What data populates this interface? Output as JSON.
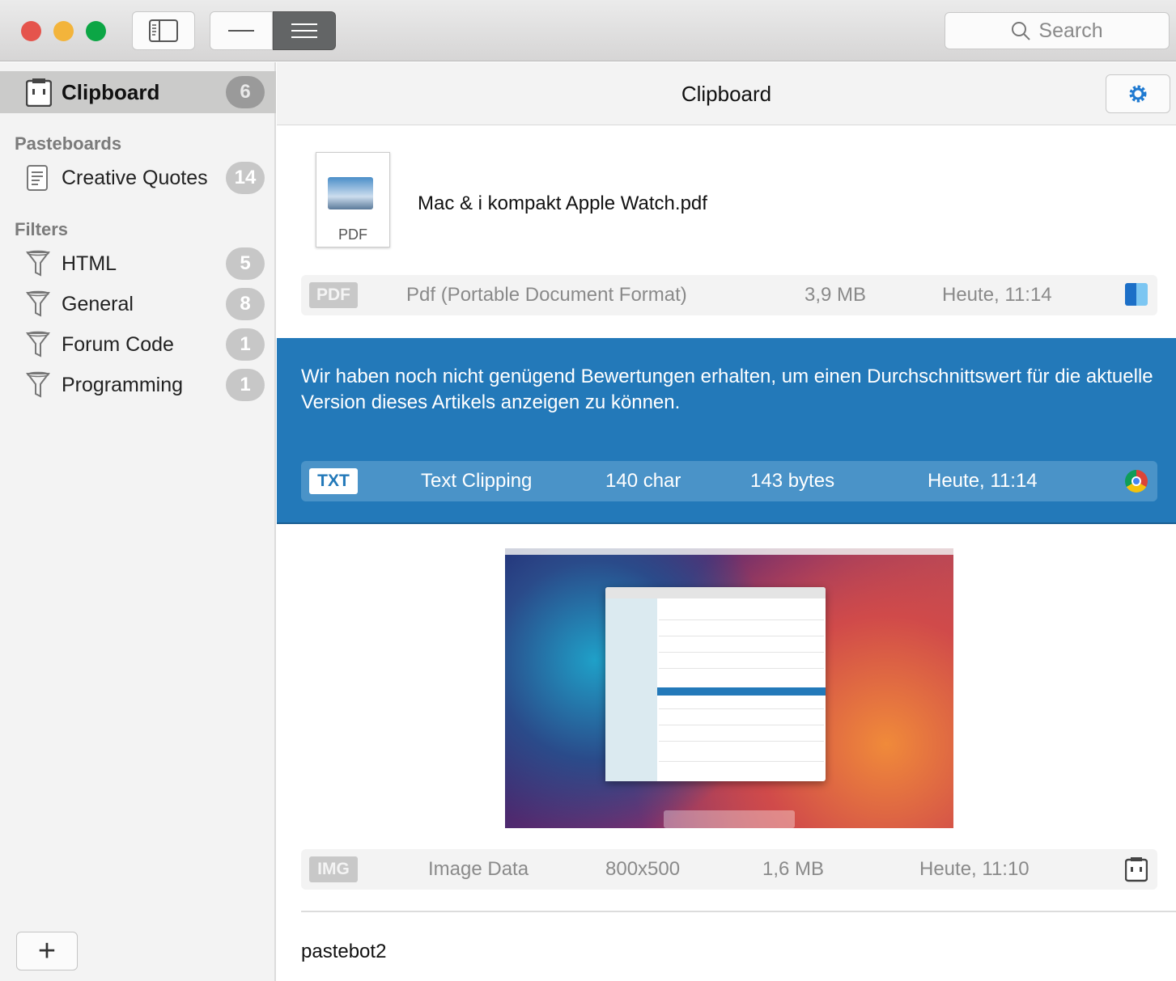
{
  "toolbar": {
    "search_placeholder": "Search"
  },
  "sidebar": {
    "clipboard": {
      "label": "Clipboard",
      "count": "6"
    },
    "pasteboards_header": "Pasteboards",
    "pasteboards": [
      {
        "label": "Creative Quotes",
        "count": "14"
      }
    ],
    "filters_header": "Filters",
    "filters": [
      {
        "label": "HTML",
        "count": "5"
      },
      {
        "label": "General",
        "count": "8"
      },
      {
        "label": "Forum Code",
        "count": "1"
      },
      {
        "label": "Programming",
        "count": "1"
      }
    ],
    "add_label": "+"
  },
  "main": {
    "title": "Clipboard",
    "items": [
      {
        "file_label": "PDF",
        "name": "Mac & i kompakt Apple Watch.pdf",
        "tag": "PDF",
        "type": "Pdf (Portable Document Format)",
        "size": "3,9 MB",
        "time": "Heute, 11:14",
        "source_icon": "finder-icon"
      },
      {
        "text": "Wir haben noch nicht genügend Bewertungen erhalten, um einen Durchschnittswert für die aktuelle Version dieses Artikels anzeigen zu können.",
        "tag": "TXT",
        "type": "Text Clipping",
        "chars": "140 char",
        "size": "143 bytes",
        "time": "Heute, 11:14",
        "source_icon": "chrome-icon"
      },
      {
        "tag": "IMG",
        "type": "Image Data",
        "dimensions": "800x500",
        "size": "1,6 MB",
        "time": "Heute, 11:10",
        "source_icon": "pastebot-icon"
      },
      {
        "text": "pastebot2"
      }
    ]
  },
  "colors": {
    "selection": "#2379b9",
    "accent": "#1f7ad1"
  }
}
